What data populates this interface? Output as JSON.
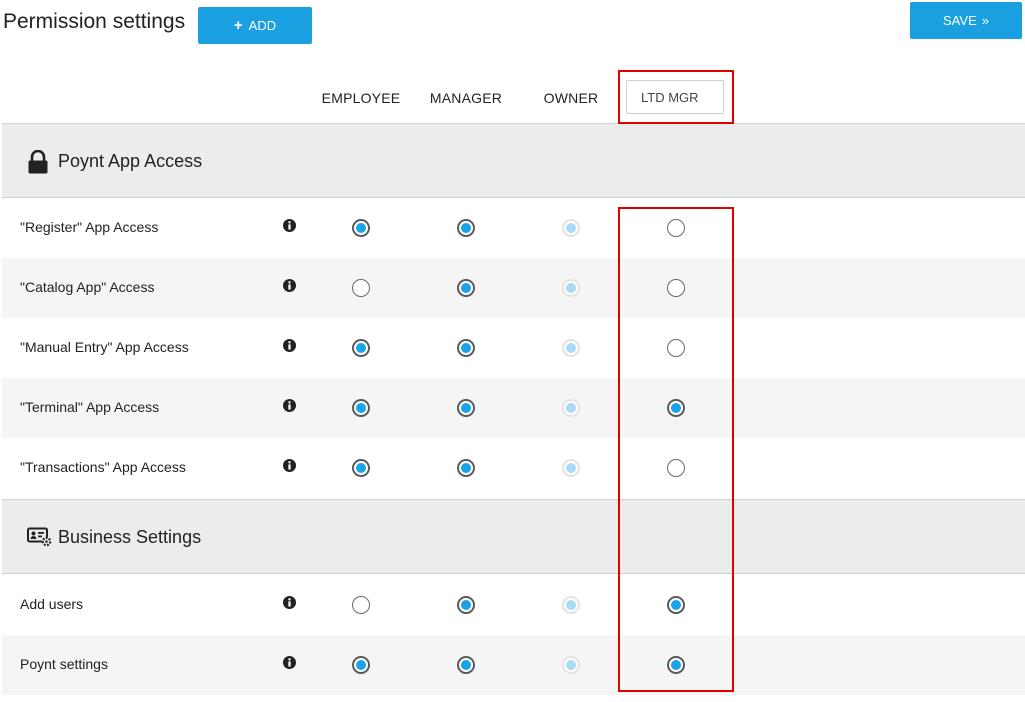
{
  "header": {
    "title": "Permission settings",
    "add_label": "ADD",
    "save_label": "SAVE",
    "save_chevron": "»"
  },
  "columns": {
    "employee": "EMPLOYEE",
    "manager": "MANAGER",
    "owner": "OWNER",
    "ltd_mgr_value": "LTD MGR"
  },
  "sections": [
    {
      "title": "Poynt App Access",
      "icon": "lock-icon",
      "rows": [
        {
          "label": "\"Register\" App Access",
          "employee": "on",
          "manager": "on",
          "owner": "disabled-on",
          "ltd_mgr": "off"
        },
        {
          "label": "\"Catalog App\" Access",
          "employee": "off",
          "manager": "on",
          "owner": "disabled-on",
          "ltd_mgr": "off"
        },
        {
          "label": "\"Manual Entry\" App Access",
          "employee": "on",
          "manager": "on",
          "owner": "disabled-on",
          "ltd_mgr": "off"
        },
        {
          "label": "\"Terminal\" App Access",
          "employee": "on",
          "manager": "on",
          "owner": "disabled-on",
          "ltd_mgr": "on"
        },
        {
          "label": "\"Transactions\" App Access",
          "employee": "on",
          "manager": "on",
          "owner": "disabled-on",
          "ltd_mgr": "off"
        }
      ]
    },
    {
      "title": "Business Settings",
      "icon": "business-settings-icon",
      "rows": [
        {
          "label": "Add users",
          "employee": "off",
          "manager": "on",
          "owner": "disabled-on",
          "ltd_mgr": "on"
        },
        {
          "label": "Poynt settings",
          "employee": "on",
          "manager": "on",
          "owner": "disabled-on",
          "ltd_mgr": "on"
        }
      ]
    }
  ],
  "colors": {
    "accent": "#1a9fe0",
    "highlight": "#e00000",
    "radio_checked": "#1aa3e8",
    "radio_disabled": "#a9dbf4"
  }
}
